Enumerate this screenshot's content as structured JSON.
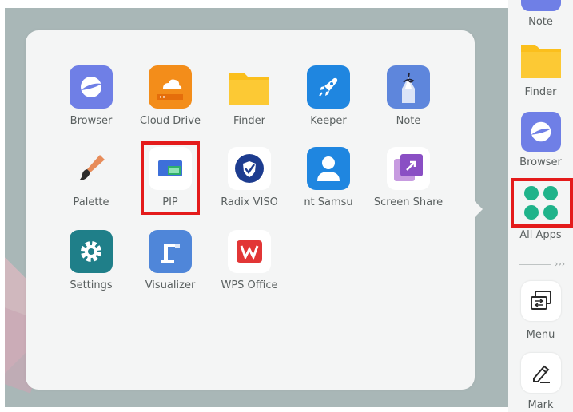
{
  "apps": [
    {
      "id": "browser",
      "label": "Browser"
    },
    {
      "id": "cloud-drive",
      "label": "Cloud Drive"
    },
    {
      "id": "finder",
      "label": "Finder"
    },
    {
      "id": "keeper",
      "label": "Keeper"
    },
    {
      "id": "note",
      "label": "Note"
    },
    {
      "id": "palette",
      "label": "Palette"
    },
    {
      "id": "pip",
      "label": "PIP"
    },
    {
      "id": "radix-viso",
      "label": "Radix VISO"
    },
    {
      "id": "samsung",
      "label": "nt    Samsu"
    },
    {
      "id": "screen-share",
      "label": "Screen Share"
    },
    {
      "id": "settings",
      "label": "Settings"
    },
    {
      "id": "visualizer",
      "label": "Visualizer"
    },
    {
      "id": "wps-office",
      "label": "WPS Office"
    }
  ],
  "sidebar": {
    "note_label": "Note",
    "finder_label": "Finder",
    "browser_label": "Browser",
    "all_apps_label": "All Apps",
    "menu_label": "Menu",
    "mark_label": "Mark",
    "chevron": "›››"
  },
  "colors": {
    "highlight": "#e41b1b",
    "all_apps_dots": "#1fb38a",
    "browser_bg": "#6f7fe6",
    "cloud_drive_bg": "#f38d1a",
    "finder_bg": "#fbbf1c",
    "keeper_bg": "#1f86e0",
    "note_bg": "#5e86dc"
  }
}
